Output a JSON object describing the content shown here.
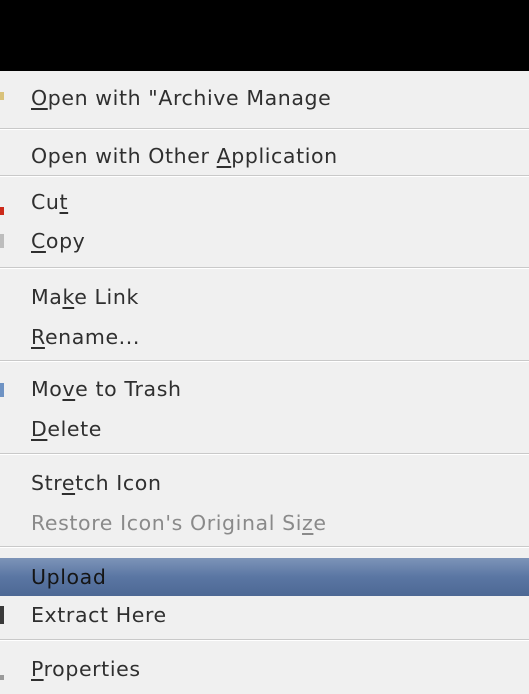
{
  "menu": {
    "open_with_archive": [
      "",
      "O",
      "pen with \"Archive Manage"
    ],
    "open_with_other": [
      "Open with Other ",
      "A",
      "pplication"
    ],
    "cut": [
      "Cu",
      "t",
      ""
    ],
    "copy": [
      "",
      "C",
      "opy"
    ],
    "make_link": [
      "Ma",
      "k",
      "e Link"
    ],
    "rename": [
      "",
      "R",
      "ename..."
    ],
    "move_to_trash": [
      "Mo",
      "v",
      "e to Trash"
    ],
    "delete": [
      "",
      "D",
      "elete"
    ],
    "stretch_icon": [
      "Str",
      "e",
      "tch Icon"
    ],
    "restore_icon": [
      "Restore Icon's Original Si",
      "z",
      "e"
    ],
    "upload": [
      "Upload"
    ],
    "extract_here": [
      "Extract Here"
    ],
    "properties": [
      "",
      "P",
      "roperties"
    ]
  },
  "colors": {
    "topbar": "#000000",
    "menu_bg": "#f0f0f0",
    "highlight_top": "#7d94b8",
    "highlight_bottom": "#4d6894",
    "text": "#2f2f2f",
    "disabled_text": "#8a8a8a"
  }
}
